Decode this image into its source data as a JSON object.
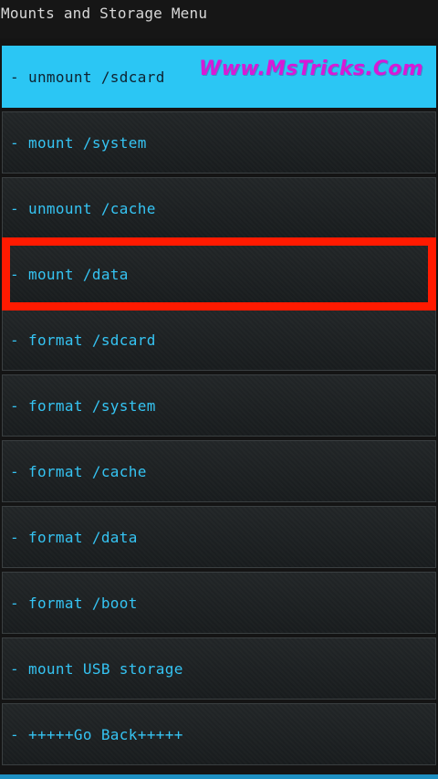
{
  "header": {
    "title": "Mounts and Storage Menu"
  },
  "menu": {
    "items": [
      {
        "label": "- unmount /sdcard"
      },
      {
        "label": "- mount /system"
      },
      {
        "label": "- unmount /cache"
      },
      {
        "label": "- mount /data"
      },
      {
        "label": "- format /sdcard"
      },
      {
        "label": "- format /system"
      },
      {
        "label": "- format /cache"
      },
      {
        "label": "- format /data"
      },
      {
        "label": "- format /boot"
      },
      {
        "label": "- mount USB storage"
      },
      {
        "label": "- +++++Go Back+++++"
      }
    ]
  },
  "overlay": {
    "watermark": "Www.MsTricks.Com"
  },
  "colors": {
    "accent": "#2bc6f4",
    "highlight": "#ff1a00",
    "watermark": "#d71ad7"
  }
}
